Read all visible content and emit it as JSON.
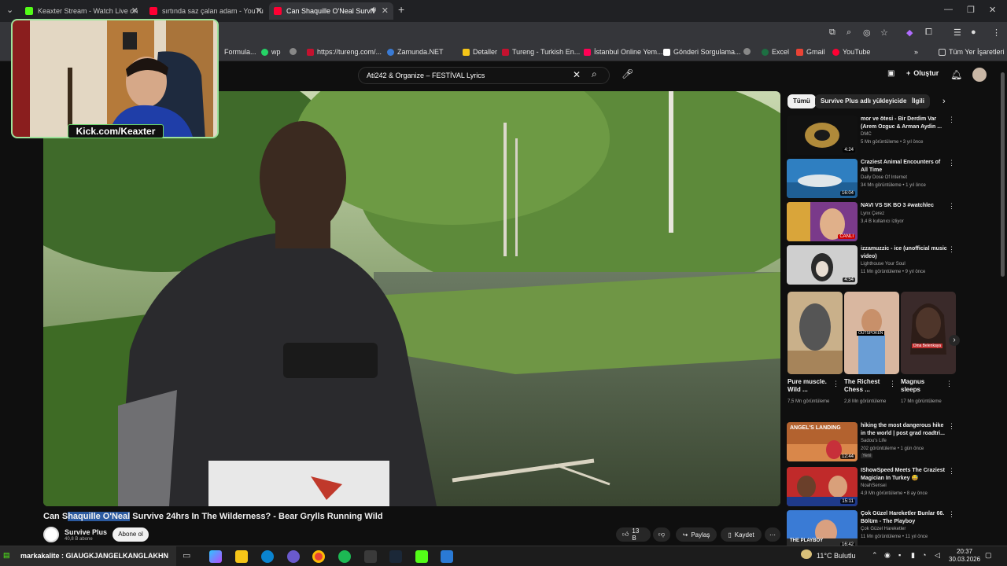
{
  "tabs": [
    {
      "title": "Keaxter Stream - Watch Live on",
      "color": "#53fc18"
    },
    {
      "title": "sırtında saz çalan adam - YouTu",
      "color": "#ff0033"
    },
    {
      "title": "Can Shaquille O'Neal Surviv",
      "color": "#ff0033"
    }
  ],
  "bookmarks": [
    {
      "label": "Formula...",
      "color": "#e10600"
    },
    {
      "label": "wp",
      "color": "#25d366"
    },
    {
      "label": "https://tureng.com/...",
      "color": "#c4122f"
    },
    {
      "label": "Zamunda.NET",
      "color": "#3a7bd5"
    },
    {
      "label": "Detaller",
      "color": "#f5c518"
    },
    {
      "label": "Tureng - Turkish En...",
      "color": "#c4122f"
    },
    {
      "label": "İstanbul Online Yem...",
      "color": "#ff0055"
    },
    {
      "label": "Gönderi Sorgulama...",
      "color": "#ffffff"
    },
    {
      "label": "Excel",
      "color": "#1d6f42"
    },
    {
      "label": "Gmail",
      "color": "#ea4335"
    },
    {
      "label": "YouTube",
      "color": "#ff0033"
    }
  ],
  "bookmarks_all": "Tüm Yer İşaretleri",
  "search": {
    "value": "Ati242 & Organize – FESTİVAL Lyrics"
  },
  "header": {
    "create_label": "Oluştur"
  },
  "webcam": {
    "tag": "Kick.com/Keaxter"
  },
  "video": {
    "title_pre": "Can S",
    "title_highlight": "haquille O'Neal",
    "title_post": " Survive 24hrs In The Wilderness? - Bear Grylls Running Wild"
  },
  "channel": {
    "name": "Survive Plus",
    "subs": "40,8 B abone",
    "subscribe_label": "Abone ol"
  },
  "actions": {
    "likes": "13 B",
    "share": "Paylaş",
    "save": "Kaydet"
  },
  "chips": [
    "Tümü",
    "Survive Plus adlı yükleyiciden",
    "İlgili"
  ],
  "recs_top": [
    {
      "title": "mor ve ötesi - Bir Derdim Var (Arem Ozguc & Arman Aydin ...",
      "channel": "DMC",
      "meta": "5 Mn görüntüleme • 3 yıl önce",
      "duration": "4:24"
    },
    {
      "title": "Craziest Animal Encounters of All Time",
      "channel": "Daily Dose Of Internet",
      "meta": "34 Mn görüntüleme • 1 yıl önce",
      "duration": "16:04"
    },
    {
      "title": "NAVI VS SK BO 3 #watchlec",
      "channel": "Lynx Çerez",
      "meta": "3,4 B kullanıcı izliyor",
      "duration": "CANLI"
    },
    {
      "title": "izzamuzzic - ice (unofficial music video)",
      "channel": "Lighthouse Your Soul",
      "meta": "11 Mn görüntüleme • 9 yıl önce",
      "duration": "4:54"
    }
  ],
  "shorts": [
    {
      "title": "Pure muscle. Wild ...",
      "views": "7,5 Mn görüntüleme"
    },
    {
      "title": "The Richest Chess ...",
      "views": "2,8 Mn görüntüleme"
    },
    {
      "title": "Magnus sleeps",
      "views": "17 Mn görüntüleme"
    }
  ],
  "shorts_thumb_text": [
    "",
    "OUTSPOKEN",
    "Dina Belenkaya"
  ],
  "recs_bottom": [
    {
      "title": "hiking the most dangerous hike in the world | post grad roadtri...",
      "channel": "Sadou's Life",
      "meta": "202 görüntüleme • 1 gün önce",
      "badge": "Yeni",
      "duration": "12:44",
      "thumb_text": "ANGEL'S LANDING"
    },
    {
      "title": "IShowSpeed Meets The Craziest Magician In Turkey 😅",
      "channel": "NoahSensei",
      "meta": "4,9 Mn görüntüleme • 8 ay önce",
      "badge": "",
      "duration": "15:11",
      "thumb_text": ""
    },
    {
      "title": "Çok Güzel Hareketler Bunlar 66. Bölüm - The Playboy",
      "channel": "Çok Güzel Hareketler",
      "meta": "11 Mn görüntüleme • 11 yıl önce",
      "badge": "",
      "duration": "16:42",
      "thumb_text": "THE PLAYBOY"
    }
  ],
  "taskbar": {
    "ticker": "markakalite : GIAUGKJANGELKANGLAKHN",
    "weather": "11°C  Bulutlu",
    "time": "20:37",
    "date": "30.03.2026"
  },
  "colors": {
    "bg": "#0f0f0f",
    "accent": "#ff0033",
    "kick": "#53fc18"
  }
}
